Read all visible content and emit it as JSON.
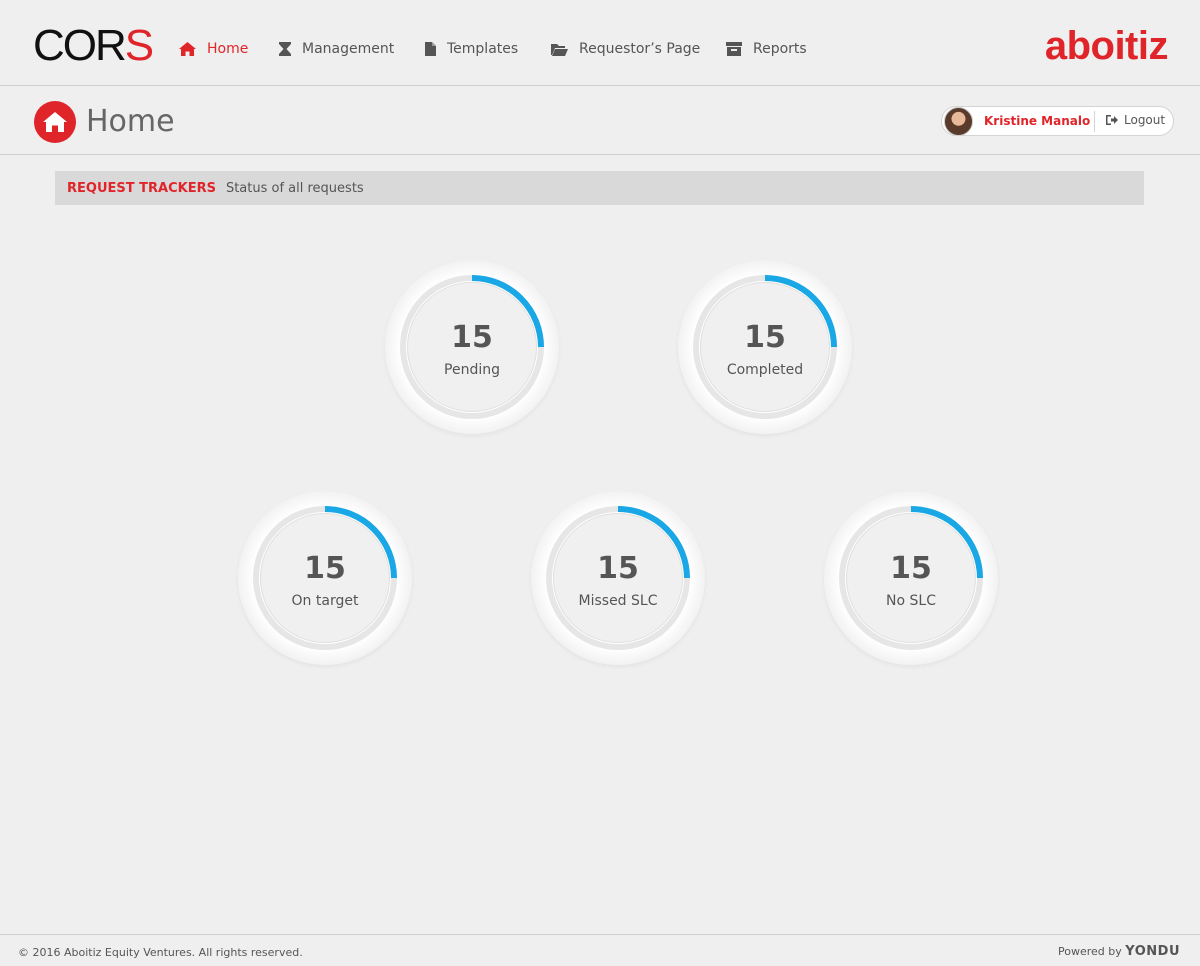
{
  "app": {
    "logo_prefix": "COR",
    "logo_suffix": "S",
    "brand": "aboitiz"
  },
  "nav": {
    "items": [
      {
        "label": "Home",
        "icon": "home-icon"
      },
      {
        "label": "Management",
        "icon": "hourglass-icon"
      },
      {
        "label": "Templates",
        "icon": "file-icon"
      },
      {
        "label": "Requestor’s Page",
        "icon": "folder-open-icon"
      },
      {
        "label": "Reports",
        "icon": "archive-icon"
      }
    ],
    "active": "Home"
  },
  "page": {
    "title": "Home"
  },
  "user": {
    "name": "Kristine Manalo",
    "logout_label": "Logout"
  },
  "section": {
    "title": "REQUEST TRACKERS",
    "subtitle": "Status of all requests"
  },
  "trackers": [
    {
      "count": "15",
      "label": "Pending",
      "progress": 0.25
    },
    {
      "count": "15",
      "label": "Completed",
      "progress": 0.25
    },
    {
      "count": "15",
      "label": "On target",
      "progress": 0.25
    },
    {
      "count": "15",
      "label": "Missed SLC",
      "progress": 0.25
    },
    {
      "count": "15",
      "label": "No SLC",
      "progress": 0.25
    }
  ],
  "footer": {
    "copyright": "© 2016 Aboitiz Equity Ventures. All rights reserved.",
    "powered_prefix": "Powered by",
    "powered_brand": "YONDU"
  },
  "colors": {
    "accent": "#e0252a",
    "progress": "#1aa7e6",
    "track": "#e6e6e6"
  }
}
